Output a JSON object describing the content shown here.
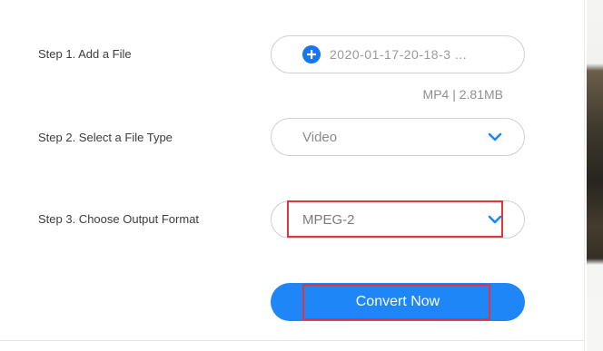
{
  "steps": {
    "add_file": {
      "label": "Step 1. Add a File",
      "file_name": "2020-01-17-20-18-3 ...",
      "file_meta": "MP4 | 2.81MB",
      "icon": "plus-circle-icon"
    },
    "file_type": {
      "label": "Step 2. Select a File Type",
      "selected": "Video",
      "icon": "chevron-down-icon"
    },
    "output_format": {
      "label": "Step 3. Choose Output Format",
      "selected": "MPEG-2",
      "icon": "chevron-down-icon"
    }
  },
  "convert_button": {
    "label": "Convert Now"
  },
  "colors": {
    "accent": "#1f86f7",
    "highlight": "#e0353c"
  }
}
